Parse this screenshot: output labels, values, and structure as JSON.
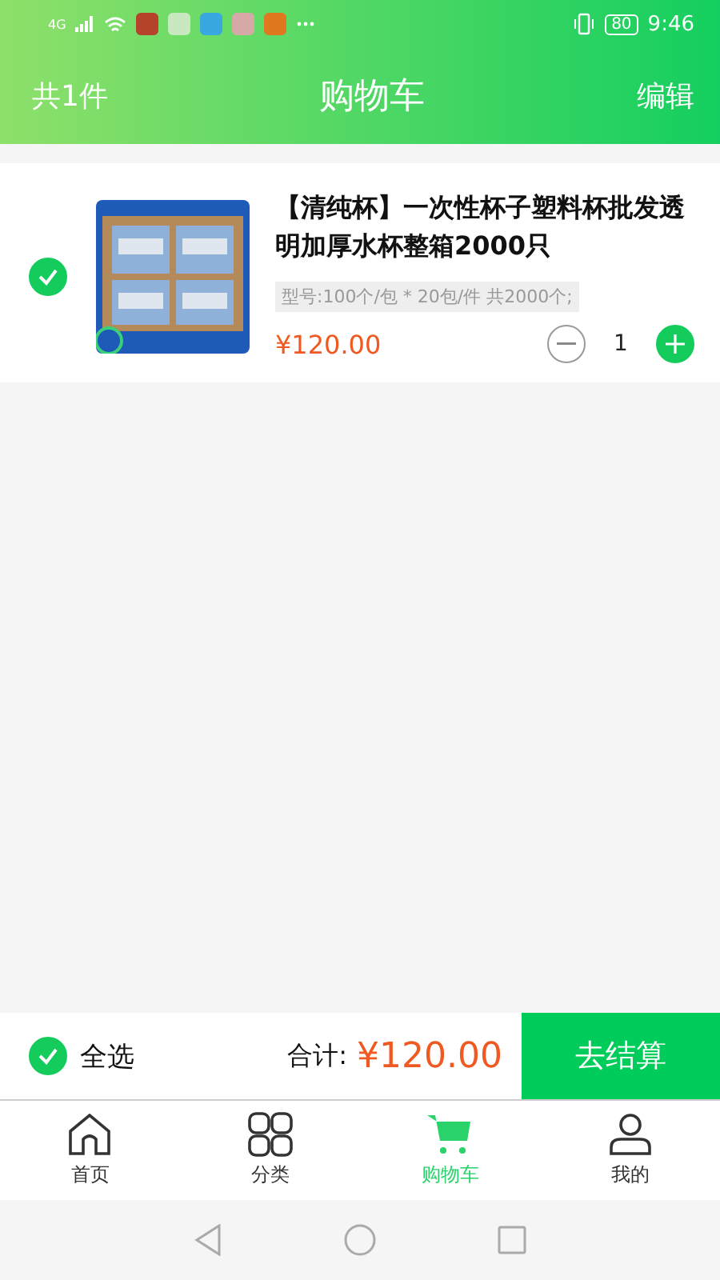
{
  "status_bar": {
    "network": "4G",
    "battery": "80",
    "time": "9:46"
  },
  "header": {
    "count": "共1件",
    "title": "购物车",
    "action": "编辑"
  },
  "cart_items": [
    {
      "checked": true,
      "title": "【清纯杯】一次性杯子塑料杯批发透明加厚水杯整箱2000只",
      "spec": "型号:100个/包 * 20包/件 共2000个;",
      "price": "¥120.00",
      "quantity": "1"
    }
  ],
  "footer": {
    "select_all": {
      "label": "全选",
      "checked": true
    },
    "total_label": "合计:",
    "total": "¥120.00",
    "checkout": "去结算"
  },
  "tabs": [
    {
      "label": "首页",
      "kind": "home",
      "selected": false
    },
    {
      "label": "分类",
      "kind": "grid",
      "selected": false
    },
    {
      "label": "购物车",
      "kind": "cart",
      "selected": true
    },
    {
      "label": "我的",
      "kind": "user",
      "selected": false
    }
  ]
}
